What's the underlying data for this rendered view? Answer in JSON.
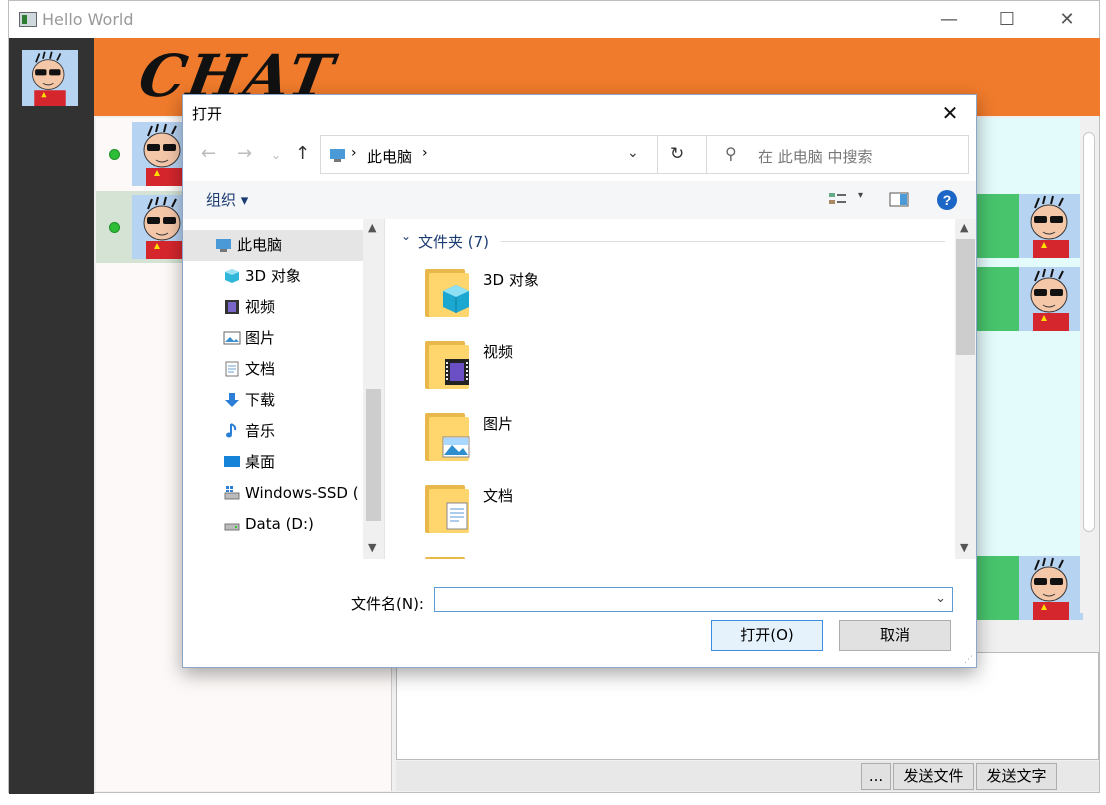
{
  "window": {
    "title": "Hello World",
    "minimize": "—",
    "maximize": "☐",
    "close": "✕"
  },
  "header": {
    "logo": "CHAT"
  },
  "bottom": {
    "more_label": "...",
    "send_file_label": "发送文件",
    "send_text_label": "发送文字"
  },
  "dialog": {
    "title": "打开",
    "close": "✕",
    "address": "此电脑",
    "search_placeholder": "在 此电脑 中搜索",
    "organize_label": "组织 ▾",
    "tree": [
      "此电脑",
      "3D 对象",
      "视频",
      "图片",
      "文档",
      "下载",
      "音乐",
      "桌面",
      "Windows-SSD (",
      "Data (D:)"
    ],
    "group_label": "文件夹 (7)",
    "folders": [
      "3D 对象",
      "视频",
      "图片",
      "文档"
    ],
    "filename_label": "文件名(N):",
    "filename_value": "",
    "open_label": "打开(O)",
    "cancel_label": "取消"
  },
  "colors": {
    "header": "#f07b2c",
    "sidebar": "#323232",
    "chat_bg": "#e4fbfb",
    "bubble": "#48c46d",
    "online": "#2dbd37"
  }
}
